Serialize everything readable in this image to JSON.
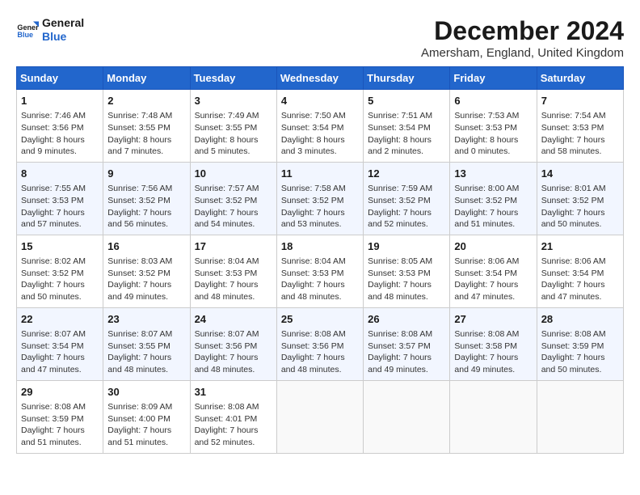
{
  "logo": {
    "line1": "General",
    "line2": "Blue"
  },
  "title": "December 2024",
  "location": "Amersham, England, United Kingdom",
  "days_header": [
    "Sunday",
    "Monday",
    "Tuesday",
    "Wednesday",
    "Thursday",
    "Friday",
    "Saturday"
  ],
  "weeks": [
    [
      {
        "day": "1",
        "sunrise": "Sunrise: 7:46 AM",
        "sunset": "Sunset: 3:56 PM",
        "daylight": "Daylight: 8 hours and 9 minutes."
      },
      {
        "day": "2",
        "sunrise": "Sunrise: 7:48 AM",
        "sunset": "Sunset: 3:55 PM",
        "daylight": "Daylight: 8 hours and 7 minutes."
      },
      {
        "day": "3",
        "sunrise": "Sunrise: 7:49 AM",
        "sunset": "Sunset: 3:55 PM",
        "daylight": "Daylight: 8 hours and 5 minutes."
      },
      {
        "day": "4",
        "sunrise": "Sunrise: 7:50 AM",
        "sunset": "Sunset: 3:54 PM",
        "daylight": "Daylight: 8 hours and 3 minutes."
      },
      {
        "day": "5",
        "sunrise": "Sunrise: 7:51 AM",
        "sunset": "Sunset: 3:54 PM",
        "daylight": "Daylight: 8 hours and 2 minutes."
      },
      {
        "day": "6",
        "sunrise": "Sunrise: 7:53 AM",
        "sunset": "Sunset: 3:53 PM",
        "daylight": "Daylight: 8 hours and 0 minutes."
      },
      {
        "day": "7",
        "sunrise": "Sunrise: 7:54 AM",
        "sunset": "Sunset: 3:53 PM",
        "daylight": "Daylight: 7 hours and 58 minutes."
      }
    ],
    [
      {
        "day": "8",
        "sunrise": "Sunrise: 7:55 AM",
        "sunset": "Sunset: 3:53 PM",
        "daylight": "Daylight: 7 hours and 57 minutes."
      },
      {
        "day": "9",
        "sunrise": "Sunrise: 7:56 AM",
        "sunset": "Sunset: 3:52 PM",
        "daylight": "Daylight: 7 hours and 56 minutes."
      },
      {
        "day": "10",
        "sunrise": "Sunrise: 7:57 AM",
        "sunset": "Sunset: 3:52 PM",
        "daylight": "Daylight: 7 hours and 54 minutes."
      },
      {
        "day": "11",
        "sunrise": "Sunrise: 7:58 AM",
        "sunset": "Sunset: 3:52 PM",
        "daylight": "Daylight: 7 hours and 53 minutes."
      },
      {
        "day": "12",
        "sunrise": "Sunrise: 7:59 AM",
        "sunset": "Sunset: 3:52 PM",
        "daylight": "Daylight: 7 hours and 52 minutes."
      },
      {
        "day": "13",
        "sunrise": "Sunrise: 8:00 AM",
        "sunset": "Sunset: 3:52 PM",
        "daylight": "Daylight: 7 hours and 51 minutes."
      },
      {
        "day": "14",
        "sunrise": "Sunrise: 8:01 AM",
        "sunset": "Sunset: 3:52 PM",
        "daylight": "Daylight: 7 hours and 50 minutes."
      }
    ],
    [
      {
        "day": "15",
        "sunrise": "Sunrise: 8:02 AM",
        "sunset": "Sunset: 3:52 PM",
        "daylight": "Daylight: 7 hours and 50 minutes."
      },
      {
        "day": "16",
        "sunrise": "Sunrise: 8:03 AM",
        "sunset": "Sunset: 3:52 PM",
        "daylight": "Daylight: 7 hours and 49 minutes."
      },
      {
        "day": "17",
        "sunrise": "Sunrise: 8:04 AM",
        "sunset": "Sunset: 3:53 PM",
        "daylight": "Daylight: 7 hours and 48 minutes."
      },
      {
        "day": "18",
        "sunrise": "Sunrise: 8:04 AM",
        "sunset": "Sunset: 3:53 PM",
        "daylight": "Daylight: 7 hours and 48 minutes."
      },
      {
        "day": "19",
        "sunrise": "Sunrise: 8:05 AM",
        "sunset": "Sunset: 3:53 PM",
        "daylight": "Daylight: 7 hours and 48 minutes."
      },
      {
        "day": "20",
        "sunrise": "Sunrise: 8:06 AM",
        "sunset": "Sunset: 3:54 PM",
        "daylight": "Daylight: 7 hours and 47 minutes."
      },
      {
        "day": "21",
        "sunrise": "Sunrise: 8:06 AM",
        "sunset": "Sunset: 3:54 PM",
        "daylight": "Daylight: 7 hours and 47 minutes."
      }
    ],
    [
      {
        "day": "22",
        "sunrise": "Sunrise: 8:07 AM",
        "sunset": "Sunset: 3:54 PM",
        "daylight": "Daylight: 7 hours and 47 minutes."
      },
      {
        "day": "23",
        "sunrise": "Sunrise: 8:07 AM",
        "sunset": "Sunset: 3:55 PM",
        "daylight": "Daylight: 7 hours and 48 minutes."
      },
      {
        "day": "24",
        "sunrise": "Sunrise: 8:07 AM",
        "sunset": "Sunset: 3:56 PM",
        "daylight": "Daylight: 7 hours and 48 minutes."
      },
      {
        "day": "25",
        "sunrise": "Sunrise: 8:08 AM",
        "sunset": "Sunset: 3:56 PM",
        "daylight": "Daylight: 7 hours and 48 minutes."
      },
      {
        "day": "26",
        "sunrise": "Sunrise: 8:08 AM",
        "sunset": "Sunset: 3:57 PM",
        "daylight": "Daylight: 7 hours and 49 minutes."
      },
      {
        "day": "27",
        "sunrise": "Sunrise: 8:08 AM",
        "sunset": "Sunset: 3:58 PM",
        "daylight": "Daylight: 7 hours and 49 minutes."
      },
      {
        "day": "28",
        "sunrise": "Sunrise: 8:08 AM",
        "sunset": "Sunset: 3:59 PM",
        "daylight": "Daylight: 7 hours and 50 minutes."
      }
    ],
    [
      {
        "day": "29",
        "sunrise": "Sunrise: 8:08 AM",
        "sunset": "Sunset: 3:59 PM",
        "daylight": "Daylight: 7 hours and 51 minutes."
      },
      {
        "day": "30",
        "sunrise": "Sunrise: 8:09 AM",
        "sunset": "Sunset: 4:00 PM",
        "daylight": "Daylight: 7 hours and 51 minutes."
      },
      {
        "day": "31",
        "sunrise": "Sunrise: 8:08 AM",
        "sunset": "Sunset: 4:01 PM",
        "daylight": "Daylight: 7 hours and 52 minutes."
      },
      null,
      null,
      null,
      null
    ]
  ]
}
